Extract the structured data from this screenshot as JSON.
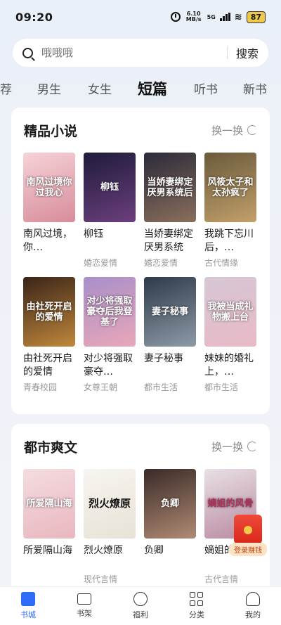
{
  "status": {
    "time": "09:20",
    "net_speed": "6.10 MB/s",
    "network": "5G",
    "battery": "87"
  },
  "search": {
    "placeholder": "哦哦哦",
    "button": "搜索"
  },
  "tabs": [
    {
      "label": "荐"
    },
    {
      "label": "男生"
    },
    {
      "label": "女生"
    },
    {
      "label": "短篇"
    },
    {
      "label": "听书"
    },
    {
      "label": "新书"
    }
  ],
  "sections": [
    {
      "title": "精品小说",
      "refresh": "换一换",
      "books": [
        {
          "title": "南风过境，你…",
          "genre": "",
          "cover_text": "南风过境你过我心",
          "color_a": "#f6d3d8",
          "color_b": "#d78c9a"
        },
        {
          "title": "柳钰",
          "genre": "婚恋爱情",
          "cover_text": "柳钰",
          "color_a": "#1e1b3a",
          "color_b": "#6c3f7e"
        },
        {
          "title": "当娇妻绑定厌男系统",
          "genre": "婚恋爱情",
          "cover_text": "当娇妻绑定厌男系统后",
          "color_a": "#2b2a3a",
          "color_b": "#8a6f5c"
        },
        {
          "title": "我跳下忘川后，…",
          "genre": "古代情缘",
          "cover_text": "风筱太子和太孙疯了",
          "color_a": "#6a5a3c",
          "color_b": "#c2a06a"
        },
        {
          "title": "由社死开启的爱情",
          "genre": "青春校园",
          "cover_text": "由社死开启的爱情",
          "color_a": "#3a2418",
          "color_b": "#c0883c"
        },
        {
          "title": "对少将强取豪夺…",
          "genre": "女尊王朝",
          "cover_text": "对少将强取豪夺后我登基了",
          "color_a": "#a88fc8",
          "color_b": "#e9a7b9"
        },
        {
          "title": "妻子秘事",
          "genre": "都市生活",
          "cover_text": "妻子秘事",
          "color_a": "#2f3a48",
          "color_b": "#8d9aa7"
        },
        {
          "title": "妹妹的婚礼上，…",
          "genre": "都市生活",
          "cover_text": "我被当成礼物搬上台",
          "color_a": "#d6c7d6",
          "color_b": "#e9b9c5"
        }
      ]
    },
    {
      "title": "都市爽文",
      "refresh": "换一换",
      "books": [
        {
          "title": "所爱隔山海",
          "genre": "",
          "cover_text": "所爱隔山海",
          "color_a": "#f4dce0",
          "color_b": "#e9b7bf"
        },
        {
          "title": "烈火燎原",
          "genre": "现代言情",
          "cover_text": "烈火燎原",
          "color_a": "#f7f5f0",
          "color_b": "#e8e2d6"
        },
        {
          "title": "负卿",
          "genre": "",
          "cover_text": "负卿",
          "color_a": "#3a2a28",
          "color_b": "#b08b74"
        },
        {
          "title": "嫡姐的…骨",
          "genre": "古代言情",
          "cover_text": "嫡姐的风骨",
          "color_a": "#e8e0e6",
          "color_b": "#b98aa0"
        }
      ]
    }
  ],
  "red_packet": {
    "label": "登录赚钱"
  },
  "nav": [
    {
      "label": "书城"
    },
    {
      "label": "书架"
    },
    {
      "label": "福利"
    },
    {
      "label": "分类"
    },
    {
      "label": "我的"
    }
  ]
}
